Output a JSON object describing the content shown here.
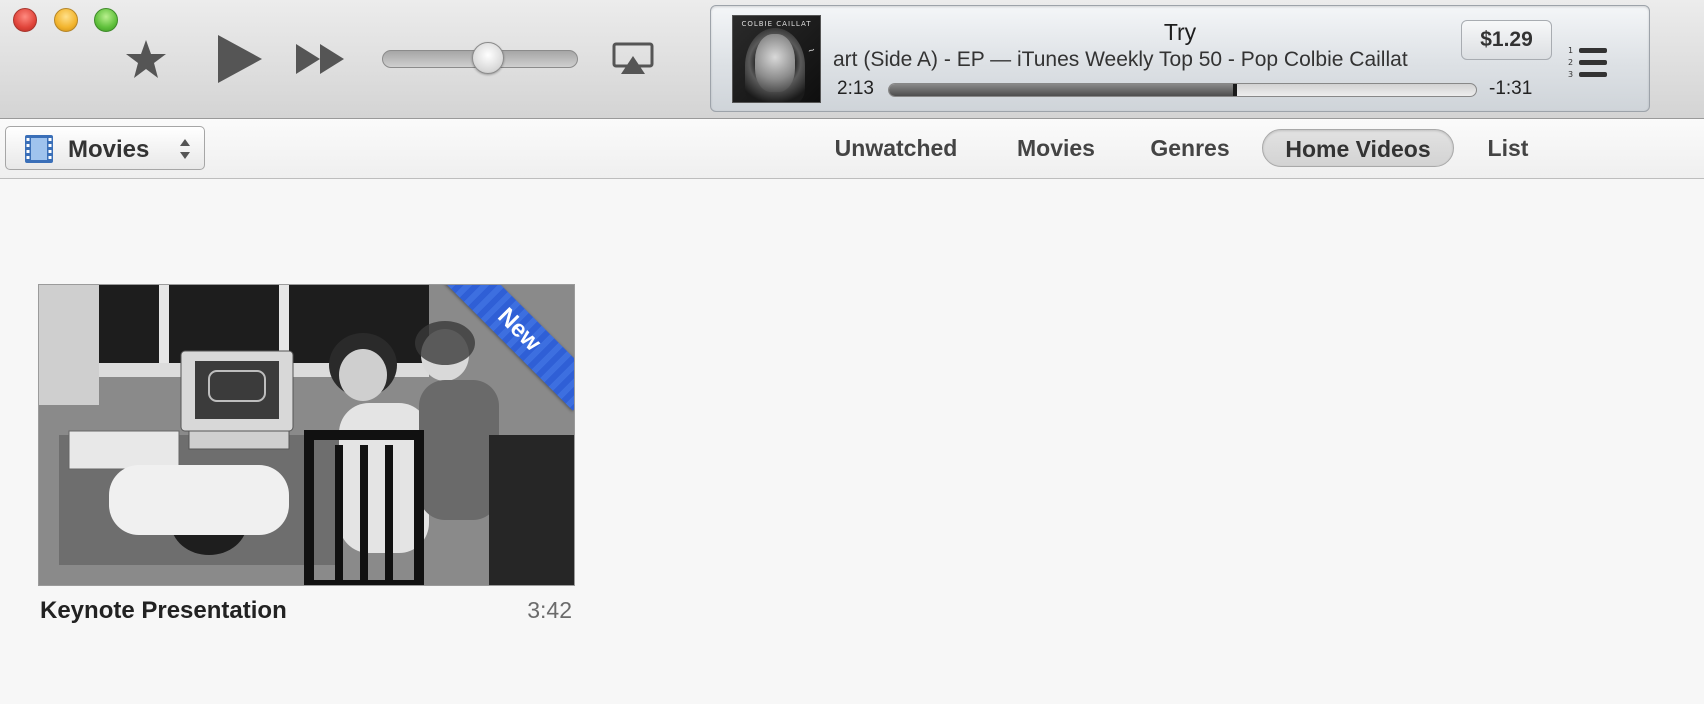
{
  "window": {
    "controls": [
      "close",
      "minimize",
      "zoom"
    ]
  },
  "player": {
    "buttons": [
      "star-icon",
      "play-icon",
      "fast-forward-icon",
      "airplay-icon"
    ],
    "volume_level": 0.55
  },
  "now_playing": {
    "title": "Try",
    "marquee": "art (Side A) - EP — iTunes Weekly Top 50 - Pop   Colbie Caillat",
    "elapsed": "2:13",
    "remaining": "-1:31",
    "progress": 0.59,
    "price": "$1.29",
    "album_art_text": "COLBIE CAILLAT"
  },
  "toolbar": {
    "media_selector": "Movies",
    "tabs": [
      {
        "label": "Unwatched",
        "active": false
      },
      {
        "label": "Movies",
        "active": false
      },
      {
        "label": "Genres",
        "active": false
      },
      {
        "label": "Home Videos",
        "active": true
      },
      {
        "label": "List",
        "active": false
      }
    ]
  },
  "content": {
    "items": [
      {
        "title": "Keynote Presentation",
        "duration": "3:42",
        "badge": "New"
      }
    ]
  },
  "colors": {
    "badge_blue": "#2f5fd6",
    "window_bg": "#f7f7f7"
  }
}
